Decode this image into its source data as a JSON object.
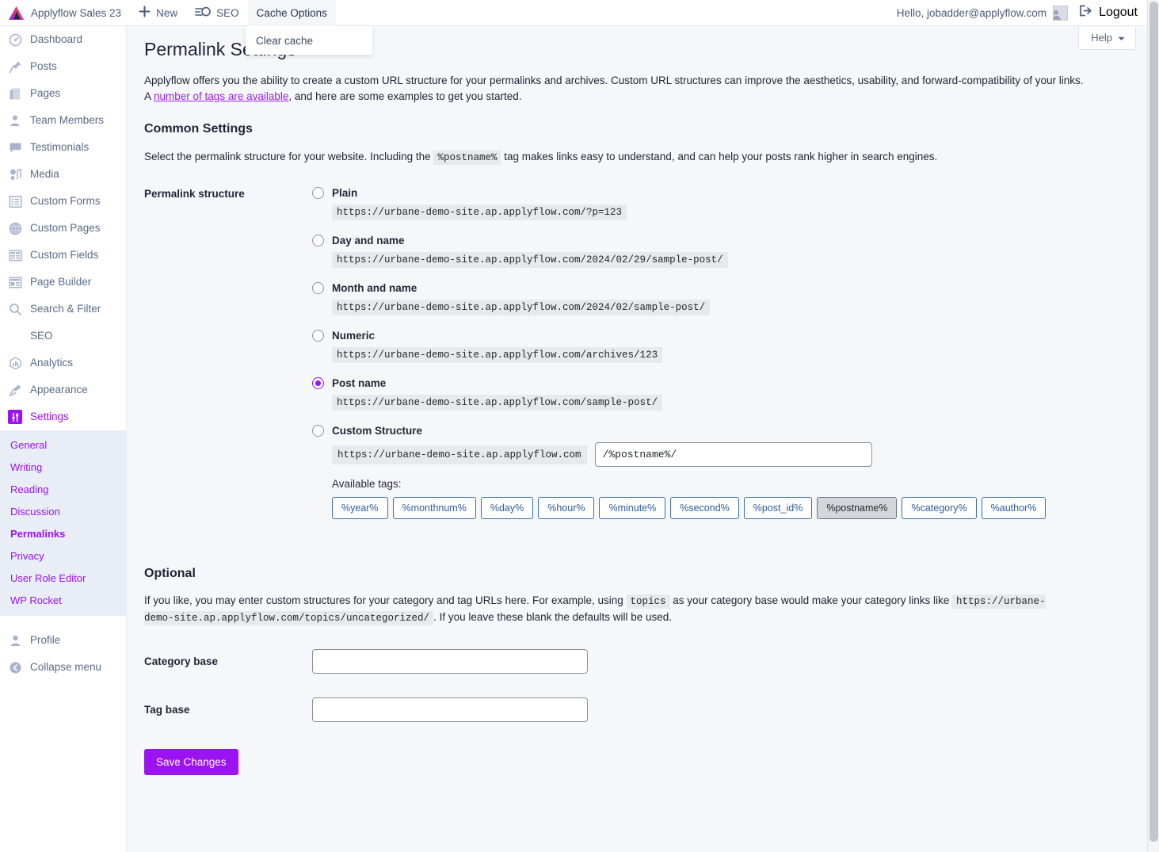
{
  "adminbar": {
    "logo_icon": "applyflow-triangle-logo",
    "site_name": "Applyflow Sales 23",
    "new_label": "New",
    "new_icon": "plus-icon",
    "seo_label": "SEO",
    "seo_icon": "sliders-icon",
    "cache_options_label": "Cache Options",
    "hello_text": "Hello, jobadder@applyflow.com",
    "avatar_icon": "user-avatar-icon",
    "logout_label": "Logout",
    "logout_icon": "logout-arrow-icon"
  },
  "cache_dropdown": {
    "items": [
      {
        "label": "Clear cache"
      }
    ]
  },
  "sidebar": {
    "items": [
      {
        "label": "Dashboard",
        "icon": "gauge-icon"
      },
      {
        "label": "Posts",
        "icon": "pin-icon"
      },
      {
        "label": "Pages",
        "icon": "page-icon"
      },
      {
        "label": "Team Members",
        "icon": "person-badge-icon"
      },
      {
        "label": "Testimonials",
        "icon": "speech-bubble-icon"
      },
      {
        "label": "Media",
        "icon": "media-icon"
      },
      {
        "label": "Custom Forms",
        "icon": "list-icon"
      },
      {
        "label": "Custom Pages",
        "icon": "globe-icon"
      },
      {
        "label": "Custom Fields",
        "icon": "table-icon"
      },
      {
        "label": "Page Builder",
        "icon": "layout-icon"
      },
      {
        "label": "Search & Filter",
        "icon": "search-icon"
      },
      {
        "label": "SEO",
        "icon": "none"
      },
      {
        "label": "Analytics",
        "icon": "chart-icon"
      },
      {
        "label": "Appearance",
        "icon": "brush-icon"
      },
      {
        "label": "Settings",
        "icon": "settings-sliders-icon",
        "current": true
      }
    ],
    "submenu": [
      {
        "label": "General"
      },
      {
        "label": "Writing"
      },
      {
        "label": "Reading"
      },
      {
        "label": "Discussion"
      },
      {
        "label": "Permalinks",
        "selected": true
      },
      {
        "label": "Privacy"
      },
      {
        "label": "User Role Editor"
      },
      {
        "label": "WP Rocket"
      }
    ],
    "footer": [
      {
        "label": "Profile",
        "icon": "person-icon"
      },
      {
        "label": "Collapse menu",
        "icon": "collapse-arrow-icon"
      }
    ]
  },
  "help": {
    "label": "Help",
    "icon": "chevron-down-icon"
  },
  "main": {
    "page_title": "Permalink Settings",
    "intro_part1": "Applyflow offers you the ability to create a custom URL structure for your permalinks and archives. Custom URL structures can improve the aesthetics, usability, and forward-compatibility of your links. A ",
    "intro_link": "number of tags are available",
    "intro_part2": ", and here are some examples to get you started.",
    "common_settings_heading": "Common Settings",
    "common_desc_part1": "Select the permalink structure for your website. Including the ",
    "common_desc_code": "%postname%",
    "common_desc_part2": " tag makes links easy to understand, and can help your posts rank higher in search engines.",
    "permalink_structure_label": "Permalink structure",
    "options": [
      {
        "label": "Plain",
        "example": "https://urbane-demo-site.ap.applyflow.com/?p=123",
        "selected": false
      },
      {
        "label": "Day and name",
        "example": "https://urbane-demo-site.ap.applyflow.com/2024/02/29/sample-post/",
        "selected": false
      },
      {
        "label": "Month and name",
        "example": "https://urbane-demo-site.ap.applyflow.com/2024/02/sample-post/",
        "selected": false
      },
      {
        "label": "Numeric",
        "example": "https://urbane-demo-site.ap.applyflow.com/archives/123",
        "selected": false
      },
      {
        "label": "Post name",
        "example": "https://urbane-demo-site.ap.applyflow.com/sample-post/",
        "selected": true
      }
    ],
    "custom_structure": {
      "label": "Custom Structure",
      "selected": false,
      "prefix": "https://urbane-demo-site.ap.applyflow.com",
      "value": "/%postname%/"
    },
    "available_tags_label": "Available tags:",
    "tags": [
      {
        "label": "%year%",
        "used": false
      },
      {
        "label": "%monthnum%",
        "used": false
      },
      {
        "label": "%day%",
        "used": false
      },
      {
        "label": "%hour%",
        "used": false
      },
      {
        "label": "%minute%",
        "used": false
      },
      {
        "label": "%second%",
        "used": false
      },
      {
        "label": "%post_id%",
        "used": false
      },
      {
        "label": "%postname%",
        "used": true
      },
      {
        "label": "%category%",
        "used": false
      },
      {
        "label": "%author%",
        "used": false
      }
    ],
    "optional_heading": "Optional",
    "optional_part1": "If you like, you may enter custom structures for your category and tag URLs here. For example, using ",
    "optional_code1": "topics",
    "optional_part2": " as your category base would make your category links like ",
    "optional_code2": "https://urbane-demo-site.ap.applyflow.com/topics/uncategorized/",
    "optional_part3": ". If you leave these blank the defaults will be used.",
    "category_base_label": "Category base",
    "category_base_value": "",
    "tag_base_label": "Tag base",
    "tag_base_value": "",
    "save_label": "Save Changes"
  },
  "colors": {
    "accent_purple": "#9b13f0",
    "sidebar_text": "#5a6a88",
    "submenu_bg": "#e8edf6",
    "page_bg": "#f6f7fb",
    "code_bg": "#e8e9ec",
    "tag_border": "#3b6ea5"
  }
}
